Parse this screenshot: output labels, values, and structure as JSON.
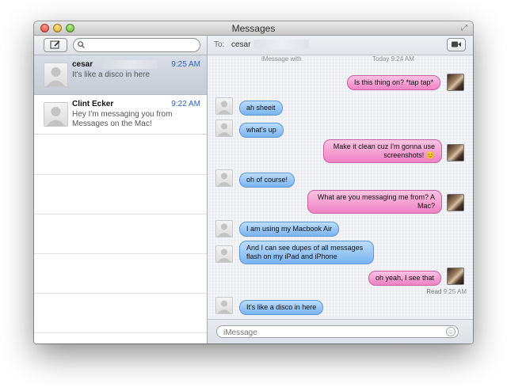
{
  "window": {
    "title": "Messages"
  },
  "sidebar": {
    "search": {
      "placeholder": "",
      "value": ""
    },
    "conversations": [
      {
        "name": "cesar",
        "time": "9:25 AM",
        "preview": "It's like a disco in here",
        "selected": true
      },
      {
        "name": "Clint Ecker",
        "time": "9:22 AM",
        "preview": "Hey I'm messaging you from Messages on the Mac!",
        "selected": false
      }
    ]
  },
  "chat": {
    "to_label": "To:",
    "to_value": "cesar",
    "header_left": "iMessage with",
    "header_right": "Today 9:24 AM",
    "messages": [
      {
        "dir": "out",
        "text": "Is this thing on? *tap tap*"
      },
      {
        "dir": "in",
        "text": "ah sheeit"
      },
      {
        "dir": "in",
        "text": "what's up"
      },
      {
        "dir": "out",
        "text": "Make it clean cuz I'm gonna use screenshots!",
        "emoji": "😊"
      },
      {
        "dir": "in",
        "text": "oh of course!"
      },
      {
        "dir": "out",
        "text": "What are you messaging me from? A Mac?"
      },
      {
        "dir": "in",
        "text": "I am using my Macbook Air"
      },
      {
        "dir": "in",
        "text": "And I can see dupes of all messages flash on my iPad and iPhone"
      },
      {
        "dir": "out",
        "text": "oh yeah, I see that"
      },
      {
        "dir": "in",
        "text": "It's like a disco in here"
      }
    ],
    "read_label": "Read",
    "read_time": "9:25 AM",
    "input_placeholder": "iMessage"
  },
  "icons": {
    "close": "close-icon",
    "minimize": "minimize-icon",
    "maximize": "maximize-icon",
    "fullscreen": "fullscreen-icon",
    "compose": "compose-icon",
    "search": "search-icon",
    "video": "video-camera-icon",
    "emoji": "emoji-icon"
  },
  "colors": {
    "incoming_bubble": "#79b4f0",
    "outgoing_bubble": "#ee82c3",
    "time_accent": "#2e62d6"
  }
}
